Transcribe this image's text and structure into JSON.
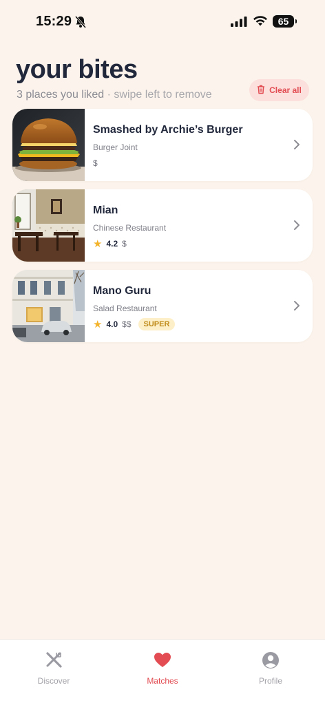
{
  "status": {
    "time": "15:29",
    "battery": "65"
  },
  "header": {
    "title": "your bites",
    "count_text": "3 places you liked",
    "hint_text": " · swipe left to remove",
    "clear_label": "Clear all"
  },
  "places": [
    {
      "name": "Smashed by Archie’s Burger",
      "category": "Burger Joint",
      "rating": "",
      "price": "$",
      "badge": ""
    },
    {
      "name": "Mian",
      "category": "Chinese Restaurant",
      "rating": "4.2",
      "price": "$",
      "badge": ""
    },
    {
      "name": "Mano Guru",
      "category": "Salad Restaurant",
      "rating": "4.0",
      "price": "$$",
      "badge": "SUPER"
    }
  ],
  "tabs": [
    {
      "label": "Discover",
      "icon": "fork-knife-icon"
    },
    {
      "label": "Matches",
      "icon": "heart-icon"
    },
    {
      "label": "Profile",
      "icon": "user-icon"
    }
  ],
  "colors": {
    "accent": "#e24c52",
    "background": "#fcf4ec",
    "star": "#f3b32a"
  }
}
